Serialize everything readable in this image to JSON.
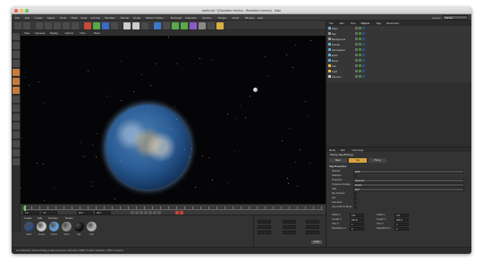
{
  "window": {
    "title": "earth.c4d * (Education Version - Restricted License) - Main",
    "traffic_colors": [
      "#ee5c54",
      "#f5be4f",
      "#62c655"
    ]
  },
  "menubar": {
    "items": [
      "File",
      "Edit",
      "Create",
      "Select",
      "Tools",
      "Mesh",
      "Snap",
      "Animate",
      "Simulate",
      "Render",
      "Sculpt",
      "Motion Tracker",
      "MoGraph",
      "Character",
      "Pipeline",
      "Plugins",
      "Script",
      "Window",
      "Help"
    ],
    "layout_label": "Layout:",
    "layout_value": "Startup"
  },
  "viewport_menu": [
    "View",
    "Cameras",
    "Display",
    "Options",
    "Filter",
    "Panel"
  ],
  "object_manager": {
    "tabs": [
      "File",
      "Edit",
      "View",
      "Objects",
      "Tags",
      "Bookmarks"
    ],
    "active_tab": "Objects",
    "objects": [
      {
        "name": "Stars",
        "color": "#6aa6e0"
      },
      {
        "name": "Sky",
        "color": "#9a9a9a"
      },
      {
        "name": "Background",
        "color": "#9a9a9a"
      },
      {
        "name": "Clouds",
        "color": "#5ab0e0"
      },
      {
        "name": "Atmosphere",
        "color": "#5ab0e0"
      },
      {
        "name": "Earth",
        "color": "#5ab0e0"
      },
      {
        "name": "Moon",
        "color": "#5ab0e0"
      },
      {
        "name": "Sun",
        "color": "#f0c040"
      },
      {
        "name": "Light",
        "color": "#f0c040"
      },
      {
        "name": "Camera",
        "color": "#c8c8c8"
      }
    ]
  },
  "attributes": {
    "tabs": [
      "Mode",
      "Edit",
      "User Data"
    ],
    "title": "Phong Tag [Phong]",
    "subtabs": [
      "Basic",
      "Tag",
      "Phong"
    ],
    "active_subtab": "Tag",
    "section": "Tag Properties",
    "rows": [
      {
        "label": "Material",
        "value": "Earth"
      },
      {
        "label": "Selection",
        "value": ""
      },
      {
        "label": "Projection",
        "value": "Spherical"
      },
      {
        "label": "Projection Display",
        "value": "Simple"
      },
      {
        "label": "Side",
        "value": "Both"
      },
      {
        "label": "Mix Textures",
        "value": ""
      },
      {
        "label": "Tile",
        "value": ""
      },
      {
        "label": "Seamless",
        "value": ""
      },
      {
        "label": "Use UVW for Bump",
        "value": ""
      }
    ],
    "coords": [
      {
        "label": "Offset U",
        "value": "0 %"
      },
      {
        "label": "Offset V",
        "value": "0 %"
      },
      {
        "label": "Length U",
        "value": "100 %"
      },
      {
        "label": "Length V",
        "value": "100 %"
      },
      {
        "label": "Tiles U",
        "value": "1"
      },
      {
        "label": "Tiles V",
        "value": "1"
      },
      {
        "label": "Repetitions U",
        "value": "0"
      },
      {
        "label": "Repetitions V",
        "value": "0"
      }
    ]
  },
  "timeline": {
    "start": "0 F",
    "current": "0 F",
    "end": "90 F",
    "max": "90 F"
  },
  "materials": {
    "menu": [
      "Create",
      "Edit",
      "Function",
      "Texture"
    ],
    "items": [
      {
        "name": "Earth",
        "color": "#2d4f82"
      },
      {
        "name": "Clouds",
        "color": "#d8d8d8"
      },
      {
        "name": "Atmos",
        "color": "#6aa6e0"
      },
      {
        "name": "Moon",
        "color": "#999999"
      },
      {
        "name": "Sky",
        "color": "#111111"
      },
      {
        "name": "Mat",
        "color": "#bbbbbb"
      }
    ]
  },
  "coordinates": {
    "apply_label": "Apply"
  },
  "statusbar": {
    "text": "Live Selection: Click and drag to select elements. Hold down SHIFT to add to selection, CTRL to remove."
  }
}
